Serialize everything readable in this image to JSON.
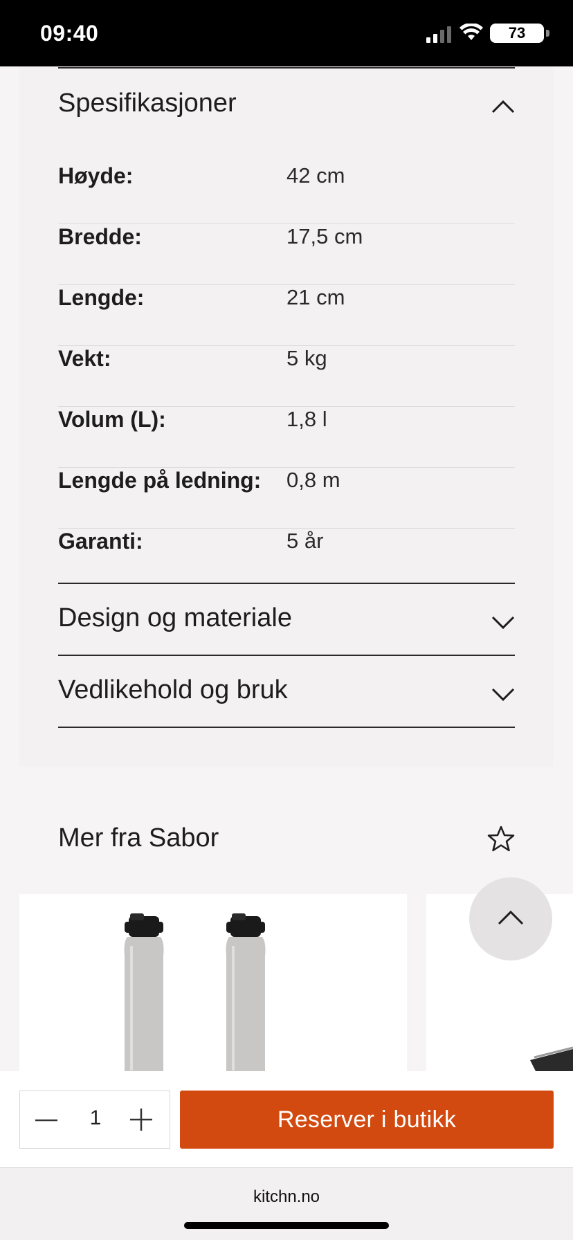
{
  "status_bar": {
    "time": "09:40",
    "battery": "73"
  },
  "specs": {
    "title": "Spesifikasjoner",
    "rows": [
      {
        "label": "Høyde:",
        "value": "42 cm"
      },
      {
        "label": "Bredde:",
        "value": "17,5 cm"
      },
      {
        "label": "Lengde:",
        "value": "21 cm"
      },
      {
        "label": "Vekt:",
        "value": "5 kg"
      },
      {
        "label": "Volum (L):",
        "value": "1,8 l"
      },
      {
        "label": "Lengde på ledning:",
        "value": "0,8 m"
      },
      {
        "label": "Garanti:",
        "value": "5 år"
      }
    ]
  },
  "sections": {
    "design": "Design og materiale",
    "maintenance": "Vedlikehold og bruk"
  },
  "more": {
    "title": "Mer fra Sabor"
  },
  "action_bar": {
    "quantity": "1",
    "reserve_label": "Reserver i butikk"
  },
  "browser": {
    "url": "kitchn.no"
  },
  "colors": {
    "accent": "#d24a0f",
    "panel": "#f3f1f1"
  },
  "icons": [
    "signal-icon",
    "wifi-icon",
    "battery-icon",
    "chevron-up-icon",
    "chevron-down-icon",
    "star-icon",
    "arrow-up-icon",
    "minus-icon",
    "plus-icon"
  ]
}
